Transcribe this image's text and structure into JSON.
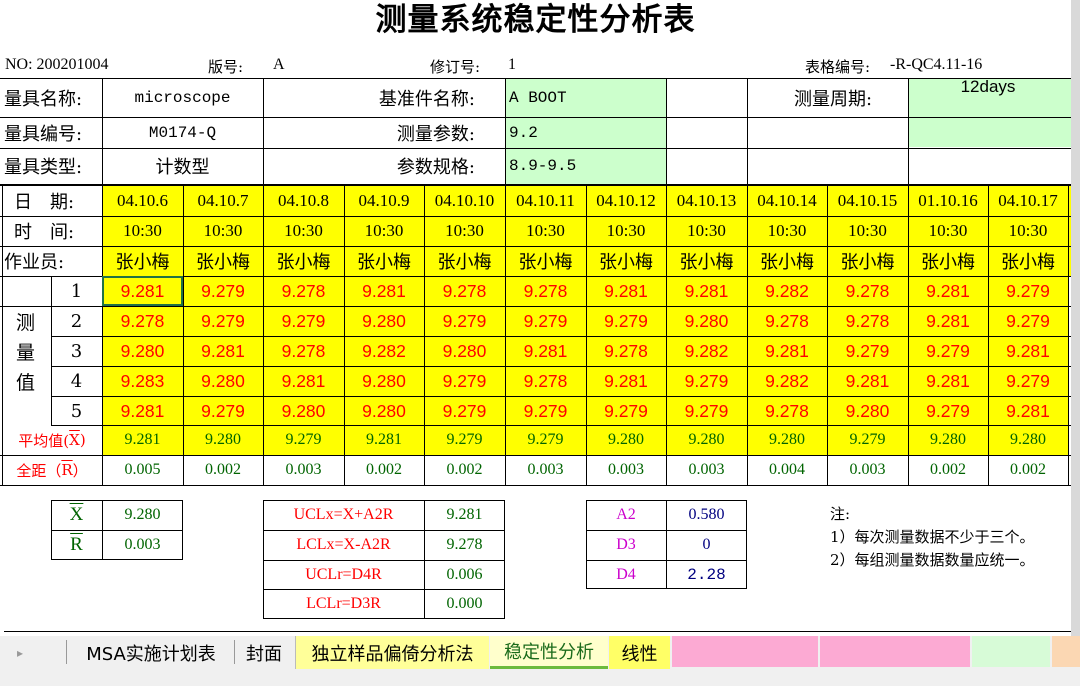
{
  "title": "测量系统稳定性分析表",
  "meta": {
    "no": "NO: 200201004",
    "version_label": "版号:",
    "version": "A",
    "revision_label": "修订号:",
    "revision": "1",
    "form_label": "表格编号:",
    "form_no": "-R-QC4.11-16"
  },
  "info": {
    "gauge_name_label": "量具名称:",
    "gauge_name": "microscope",
    "ref_name_label": "基准件名称:",
    "ref_name": "A BOOT",
    "cycle_label": "测量周期:",
    "cycle": "12days",
    "gauge_no_label": "量具编号:",
    "gauge_no": "M0174-Q",
    "param_label": "测量参数:",
    "param": "9.2",
    "gauge_type_label": "量具类型:",
    "gauge_type": "计数型",
    "spec_label": "参数规格:",
    "spec": "8.9-9.5"
  },
  "table": {
    "date_label": "日　期:",
    "time_label": "时　间:",
    "operator_label": "作业员:",
    "measure_label": [
      "测",
      "量",
      "值"
    ],
    "avg_label": "平均值(",
    "avg_sym": "X",
    "range_label": "全距（",
    "range_sym": "R",
    "dates": [
      "04.10.6",
      "04.10.7",
      "04.10.8",
      "04.10.9",
      "04.10.10",
      "04.10.11",
      "04.10.12",
      "04.10.13",
      "04.10.14",
      "04.10.15",
      "01.10.16",
      "04.10.17"
    ],
    "times": [
      "10:30",
      "10:30",
      "10:30",
      "10:30",
      "10:30",
      "10:30",
      "10:30",
      "10:30",
      "10:30",
      "10:30",
      "10:30",
      "10:30"
    ],
    "operators": [
      "张小梅",
      "张小梅",
      "张小梅",
      "张小梅",
      "张小梅",
      "张小梅",
      "张小梅",
      "张小梅",
      "张小梅",
      "张小梅",
      "张小梅",
      "张小梅"
    ],
    "row_numbers": [
      "1",
      "2",
      "3",
      "4",
      "5"
    ],
    "measurements": [
      [
        "9.281",
        "9.279",
        "9.278",
        "9.281",
        "9.278",
        "9.278",
        "9.281",
        "9.281",
        "9.282",
        "9.278",
        "9.281",
        "9.279"
      ],
      [
        "9.278",
        "9.279",
        "9.279",
        "9.280",
        "9.279",
        "9.279",
        "9.279",
        "9.280",
        "9.278",
        "9.278",
        "9.281",
        "9.279"
      ],
      [
        "9.280",
        "9.281",
        "9.278",
        "9.282",
        "9.280",
        "9.281",
        "9.278",
        "9.282",
        "9.281",
        "9.279",
        "9.279",
        "9.281"
      ],
      [
        "9.283",
        "9.280",
        "9.281",
        "9.280",
        "9.279",
        "9.278",
        "9.281",
        "9.279",
        "9.282",
        "9.281",
        "9.281",
        "9.279"
      ],
      [
        "9.281",
        "9.279",
        "9.280",
        "9.280",
        "9.279",
        "9.279",
        "9.279",
        "9.279",
        "9.278",
        "9.280",
        "9.279",
        "9.281"
      ]
    ],
    "averages": [
      "9.281",
      "9.280",
      "9.279",
      "9.281",
      "9.279",
      "9.279",
      "9.280",
      "9.280",
      "9.280",
      "9.279",
      "9.280",
      "9.280"
    ],
    "ranges": [
      "0.005",
      "0.002",
      "0.003",
      "0.002",
      "0.002",
      "0.003",
      "0.003",
      "0.003",
      "0.004",
      "0.003",
      "0.002",
      "0.002"
    ]
  },
  "summary": {
    "xbarbar_label": "X",
    "xbarbar": "9.280",
    "rbar_label": "R",
    "rbar": "0.003",
    "uclx_label": "UCLx=X+A2R",
    "uclx": "9.281",
    "lclx_label": "LCLx=X-A2R",
    "lclx": "9.278",
    "uclr_label": "UCLr=D4R",
    "uclr": "0.006",
    "lclr_label": "LCLr=D3R",
    "lclr": "0.000",
    "a2_label": "A2",
    "a2": "0.580",
    "d3_label": "D3",
    "d3": "0",
    "d4_label": "D4",
    "d4": "2.28"
  },
  "notes": {
    "title": "注:",
    "line1": "1）每次测量数据不少于三个。",
    "line2": "2）每组测量数据数量应统一。"
  },
  "sheet_tabs": [
    {
      "label": "MSA实施计划表",
      "active": false
    },
    {
      "label": "封面",
      "active": false
    },
    {
      "label": "独立样品偏倚分析法",
      "active": false
    },
    {
      "label": "稳定性分析",
      "active": true
    },
    {
      "label": "线性",
      "active": false
    }
  ],
  "colors": {
    "highlight_yellow": "#ffff00",
    "input_green": "#ccffcc",
    "measure_red": "#ff0000",
    "stat_green": "#006400",
    "tab_pink": "#ff99cc"
  }
}
